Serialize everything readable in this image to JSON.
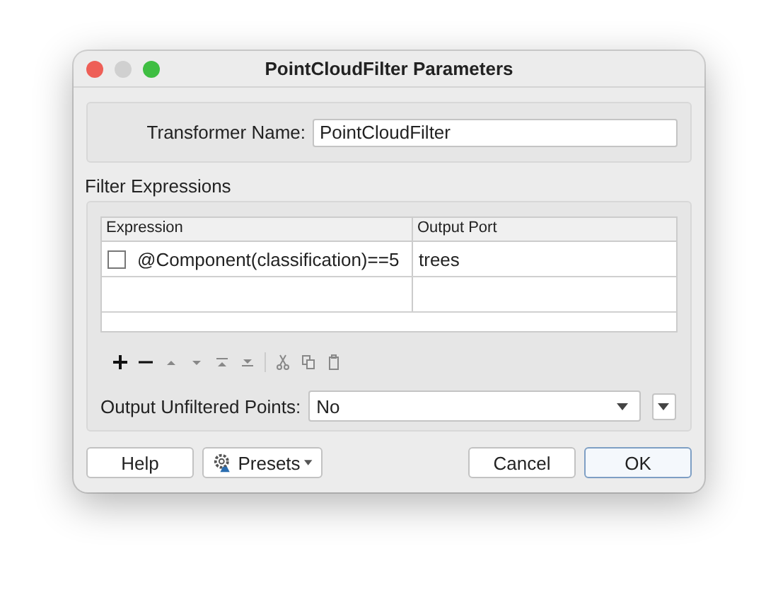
{
  "window": {
    "title": "PointCloudFilter Parameters"
  },
  "transformer_name": {
    "label": "Transformer Name:",
    "value": "PointCloudFilter"
  },
  "filter_expressions": {
    "heading": "Filter Expressions",
    "columns": [
      "Expression",
      "Output Port"
    ],
    "rows": [
      {
        "checked": false,
        "expression": "@Component(classification)==5",
        "output_port": "trees"
      }
    ],
    "tools": [
      {
        "kind": "add",
        "disabled": false
      },
      {
        "kind": "remove",
        "disabled": false
      },
      {
        "kind": "up",
        "disabled": true
      },
      {
        "kind": "down",
        "disabled": true
      },
      {
        "kind": "top",
        "disabled": true
      },
      {
        "kind": "bottom",
        "disabled": true
      },
      {
        "kind": "cut",
        "disabled": true
      },
      {
        "kind": "copy",
        "disabled": true
      },
      {
        "kind": "paste",
        "disabled": true
      }
    ]
  },
  "output_unfiltered": {
    "label": "Output Unfiltered Points:",
    "value": "No"
  },
  "buttons": [
    {
      "kind": "help",
      "label": "Help",
      "default": false
    },
    {
      "kind": "presets",
      "label": "Presets",
      "default": false
    },
    {
      "kind": "cancel",
      "label": "Cancel",
      "default": false
    },
    {
      "kind": "ok",
      "label": "OK",
      "default": true
    }
  ]
}
